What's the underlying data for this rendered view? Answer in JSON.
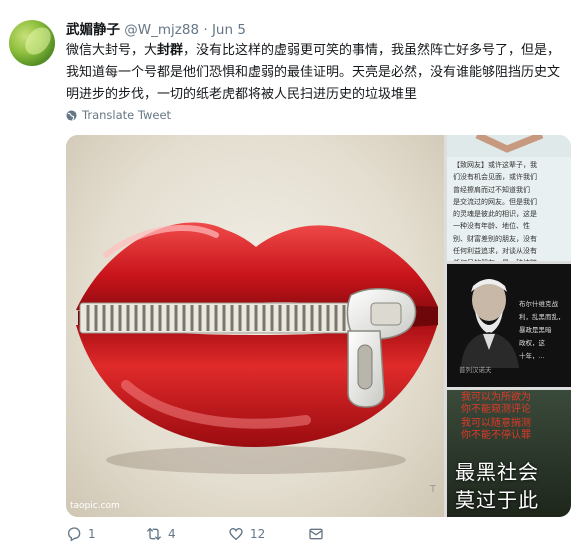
{
  "author": {
    "name": "武媚静子",
    "handle": "@W_mjz88",
    "separator": "·",
    "date": "Jun 5"
  },
  "tweet": {
    "text_part1": "微信大封号，大",
    "text_bold": "封群",
    "text_part2": "，没有比这样的虚弱更可笑的事情，我虽然阵亡好多号了，但是，我知道每一个号都是他们恐惧和虚弱的最佳证明。天亮是必然，没有谁能够阻挡历史文明进步的步伐，一切的纸老虎都将被人民扫进历史的垃圾堆里"
  },
  "translate_label": "Translate Tweet",
  "media": {
    "main_watermark": "taopic.com",
    "main_watermark_right": "T",
    "side1_text": "【致网友】或许这辈子，我\n们没有机会见面，或许我们\n曾经擦肩而过不知道我们\n是交流过的网友。但是我们\n的灵魂是彼此的相识，这是\n一种没有年龄、地位、性\n别、财富差别的朋友，没有\n任何利益追求，对谈从没有\n任何目的朋友，是一种纯粹",
    "side2_text": "布尔什维克战\n利，乱黑而乱，\n暴政是黑暗\n政权，这\n十年，...",
    "side2_caption": "普列汉诺夫",
    "side3_red1": "我可以为所欲为",
    "side3_red2": "你不能窥测评论",
    "side3_red3": "我可以随意揣测",
    "side3_red4": "你不能不停认罪",
    "side3_big1": "最黑社会",
    "side3_big2": "莫过于此"
  },
  "actions": {
    "replies": "1",
    "retweets": "4",
    "likes": "12"
  },
  "colors": {
    "secondary": "#657786",
    "text": "#14171a",
    "lip_red": "#d11a1a"
  }
}
